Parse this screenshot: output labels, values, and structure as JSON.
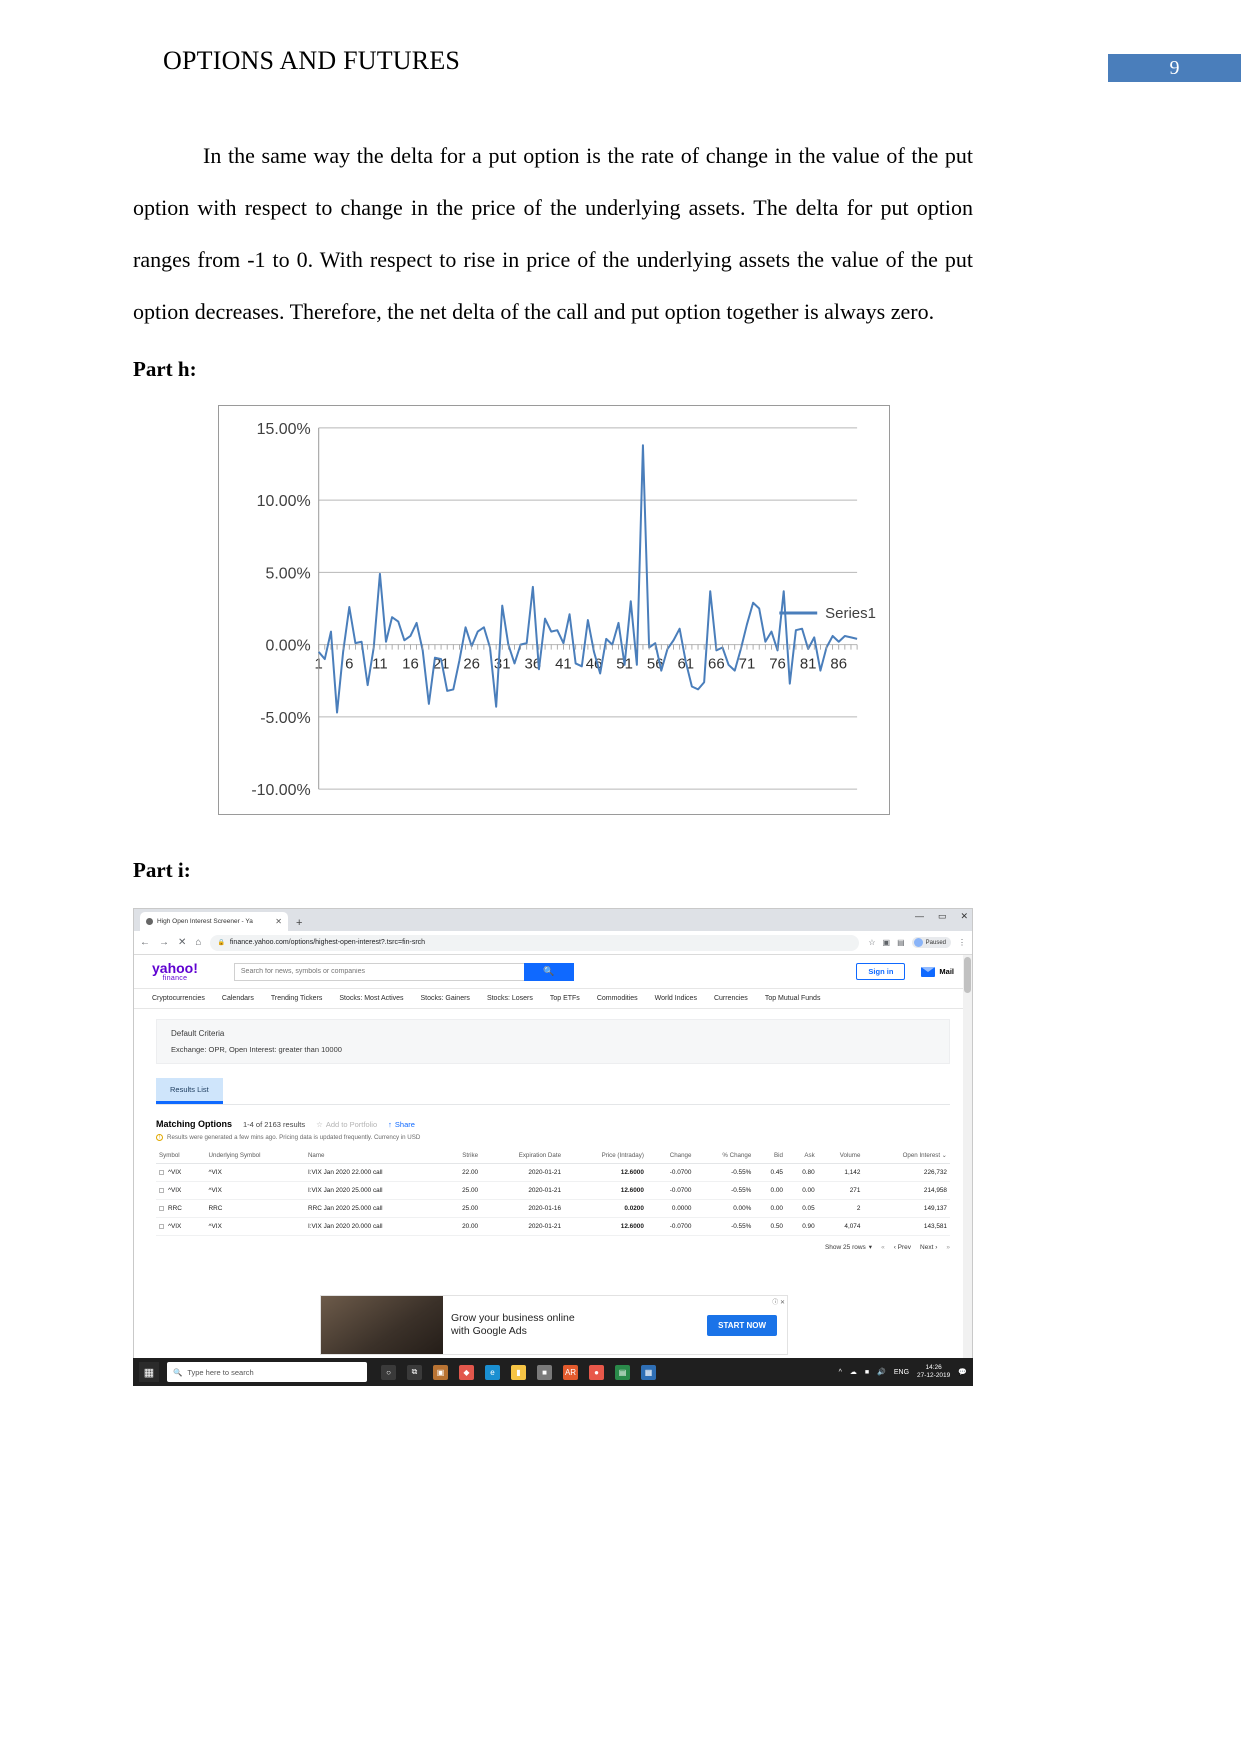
{
  "header": {
    "title": "OPTIONS AND FUTURES",
    "page_number": "9",
    "badge_color": "#4a7ebb"
  },
  "body": {
    "paragraph": "In the same way the delta for a put option is the rate of change in the value of the put option with respect to change in the price of the underlying assets. The delta for put option ranges from -1 to 0. With respect to rise in price of the underlying assets the value of the put option decreases. Therefore, the net delta of the call and put option together is always zero."
  },
  "sections": {
    "part_h": "Part h:",
    "part_i": "Part i:"
  },
  "chart_data": {
    "type": "line",
    "title": "",
    "xlabel": "",
    "ylabel": "",
    "series_name": "Series1",
    "legend_position": "right",
    "grid": true,
    "line_color": "#4a7ebb",
    "ylim": [
      -10,
      15
    ],
    "ytick_labels": [
      "15.00%",
      "10.00%",
      "5.00%",
      "0.00%",
      "-5.00%",
      "-10.00%"
    ],
    "ytick_values": [
      15,
      10,
      5,
      0,
      -5,
      -10
    ],
    "xtick_labels": [
      "1",
      "6",
      "11",
      "16",
      "21",
      "26",
      "31",
      "36",
      "41",
      "46",
      "51",
      "56",
      "61",
      "66",
      "71",
      "76",
      "81",
      "86"
    ],
    "xtick_values": [
      1,
      6,
      11,
      16,
      21,
      26,
      31,
      36,
      41,
      46,
      51,
      56,
      61,
      66,
      71,
      76,
      81,
      86
    ],
    "xlim": [
      1,
      90
    ],
    "values": [
      -0.5,
      -1.0,
      0.9,
      -4.7,
      -0.5,
      2.6,
      0.1,
      0.2,
      -2.8,
      -0.2,
      4.9,
      0.2,
      1.9,
      1.6,
      0.3,
      0.6,
      1.5,
      -0.4,
      -4.1,
      -0.9,
      -1.0,
      -3.2,
      -3.1,
      -1.1,
      1.2,
      -0.1,
      0.9,
      1.2,
      -0.2,
      -4.3,
      2.7,
      0.0,
      -1.3,
      0.0,
      0.1,
      4.0,
      -1.7,
      1.8,
      0.9,
      1.0,
      0.1,
      2.1,
      -1.3,
      -1.5,
      1.7,
      -0.5,
      -2.0,
      0.4,
      0.0,
      1.5,
      -1.4,
      3.0,
      -1.4,
      13.8,
      -0.2,
      0.1,
      -1.8,
      -0.3,
      0.3,
      1.1,
      -1.2,
      -2.9,
      -3.1,
      -2.6,
      3.7,
      -0.4,
      -0.2,
      -1.4,
      -1.8,
      -0.3,
      1.4,
      2.9,
      2.5,
      0.2,
      0.9,
      -0.4,
      3.7,
      -2.7,
      1.0,
      1.1,
      -0.3,
      0.5,
      -1.8,
      -0.2,
      0.6,
      0.2,
      0.6,
      0.5,
      0.4
    ]
  },
  "browser": {
    "tab": {
      "title": "High Open Interest Screener - Ya",
      "close": "✕"
    },
    "new_tab": "+",
    "window_controls": {
      "minimize": "—",
      "maximize": "▭",
      "close": "✕"
    },
    "nav": {
      "back": "←",
      "forward": "→",
      "stop": "✕",
      "home": "⌂"
    },
    "url": "finance.yahoo.com/options/highest-open-interest?.tsrc=fin-srch",
    "lock_icon": "lock-icon",
    "toolbar_right": {
      "bookmark": "☆",
      "ext1": "▣",
      "ext2": "▤",
      "profile_label": "Paused",
      "menu": "⋮"
    },
    "yahoo": {
      "logo": "yahoo!",
      "logo_sub": "finance",
      "search_placeholder": "Search for news, symbols or companies",
      "search_value": "",
      "search_icon": "search-icon",
      "sign_in": "Sign in",
      "mail": "Mail",
      "nav_items": [
        "Cryptocurrencies",
        "Calendars",
        "Trending Tickers",
        "Stocks: Most Actives",
        "Stocks: Gainers",
        "Stocks: Losers",
        "Top ETFs",
        "Commodities",
        "World Indices",
        "Currencies",
        "Top Mutual Funds"
      ]
    },
    "criteria": {
      "title": "Default Criteria",
      "line": "Exchange:  OPR, Open Interest:  greater than 10000"
    },
    "results_tab": "Results List",
    "matching": {
      "title": "Matching Options",
      "count": "1-4 of 2163 results",
      "add_to_portfolio": "Add to Portfolio",
      "share": "Share",
      "note": "Results were generated a few mins ago. Pricing data is updated frequently. Currency in USD"
    },
    "table": {
      "columns": [
        "Symbol",
        "Underlying Symbol",
        "Name",
        "Strike",
        "Expiration Date",
        "Price (Intraday)",
        "Change",
        "% Change",
        "Bid",
        "Ask",
        "Volume",
        "Open Interest"
      ],
      "sort_col": "Open Interest",
      "rows": [
        {
          "symbol": "^VIX",
          "underlying": "^VIX",
          "name": "I:VIX Jan 2020 22.000 call",
          "strike": "22.00",
          "expiry": "2020-01-21",
          "price": "12.6000",
          "change": "-0.0700",
          "pct_change": "-0.55%",
          "bid": "0.45",
          "ask": "0.80",
          "volume": "1,142",
          "open_interest": "226,732"
        },
        {
          "symbol": "^VIX",
          "underlying": "^VIX",
          "name": "I:VIX Jan 2020 25.000 call",
          "strike": "25.00",
          "expiry": "2020-01-21",
          "price": "12.6000",
          "change": "-0.0700",
          "pct_change": "-0.55%",
          "bid": "0.00",
          "ask": "0.00",
          "volume": "271",
          "open_interest": "214,958"
        },
        {
          "symbol": "RRC",
          "underlying": "RRC",
          "name": "RRC Jan 2020 25.000 call",
          "strike": "25.00",
          "expiry": "2020-01-16",
          "price": "0.0200",
          "change": "0.0000",
          "pct_change": "0.00%",
          "bid": "0.00",
          "ask": "0.05",
          "volume": "2",
          "open_interest": "149,137"
        },
        {
          "symbol": "^VIX",
          "underlying": "^VIX",
          "name": "I:VIX Jan 2020 20.000 call",
          "strike": "20.00",
          "expiry": "2020-01-21",
          "price": "12.6000",
          "change": "-0.0700",
          "pct_change": "-0.55%",
          "bid": "0.50",
          "ask": "0.90",
          "volume": "4,074",
          "open_interest": "143,581"
        }
      ]
    },
    "pager": {
      "rows_label": "Show 25 rows",
      "first": "«",
      "prev": "‹ Prev",
      "next": "Next ›",
      "last": "»"
    },
    "ad": {
      "headline_1": "Grow your business online",
      "headline_2": "with Google Ads",
      "cta": "START NOW",
      "close": "✕",
      "info": "ⓘ"
    }
  },
  "taskbar": {
    "start_icon": "windows-icon",
    "search_placeholder": "Type here to search",
    "search_icon": "search-icon",
    "icons": [
      "cortana-icon",
      "task-view-icon",
      "explorer-icon",
      "mozilla-icon",
      "edge-icon",
      "folder-icon",
      "camera-icon",
      "ar-icon",
      "chrome-icon",
      "excel-icon",
      "app-icon"
    ],
    "tray": {
      "chevron": "^",
      "network": "net-icon",
      "battery": "battery-icon",
      "volume": "volume-icon",
      "language": "ENG",
      "time": "14:26",
      "date": "27-12-2019",
      "action_center": "notify-icon"
    }
  }
}
